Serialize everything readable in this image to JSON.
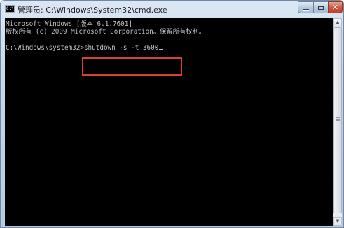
{
  "window": {
    "title": "管理员: C:\\Windows\\System32\\cmd.exe",
    "icon_text": "C:\\",
    "controls": {
      "minimize": "minimize-icon",
      "maximize": "maximize-icon",
      "close": "close-icon",
      "close_glyph": "✕"
    }
  },
  "console": {
    "line1": "Microsoft Windows [版本 6.1.7601]",
    "line2": "版权所有 (c) 2009 Microsoft Corporation。保留所有权利。",
    "prompt": "C:\\Windows\\system32>",
    "command": "shutdown -s -t 3600"
  },
  "scrollbar": {
    "up_glyph": "▲",
    "down_glyph": "▼"
  },
  "colors": {
    "console_bg": "#000000",
    "console_text": "#c0c0c0",
    "highlight": "#d9423a"
  }
}
